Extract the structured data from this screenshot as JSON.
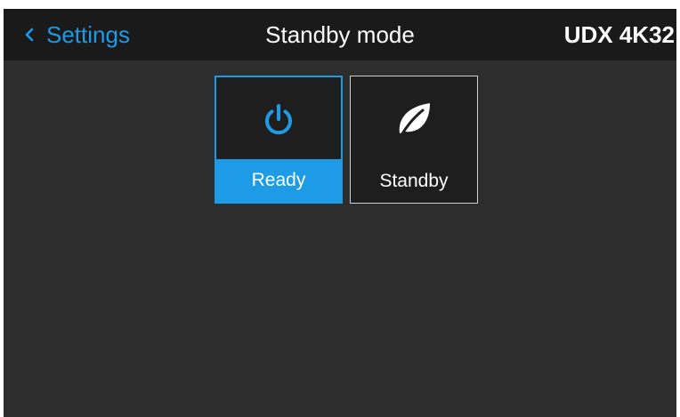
{
  "header": {
    "back_label": "Settings",
    "title": "Standby mode",
    "device_name": "UDX 4K32"
  },
  "tiles": [
    {
      "label": "Ready",
      "icon": "power-icon",
      "selected": true
    },
    {
      "label": "Standby",
      "icon": "leaf-icon",
      "selected": false
    }
  ],
  "colors": {
    "accent": "#1e9be6",
    "header_bg": "#1a1a1a",
    "screen_bg": "#2d2d2d",
    "tile_bg": "#1e1e1e"
  }
}
